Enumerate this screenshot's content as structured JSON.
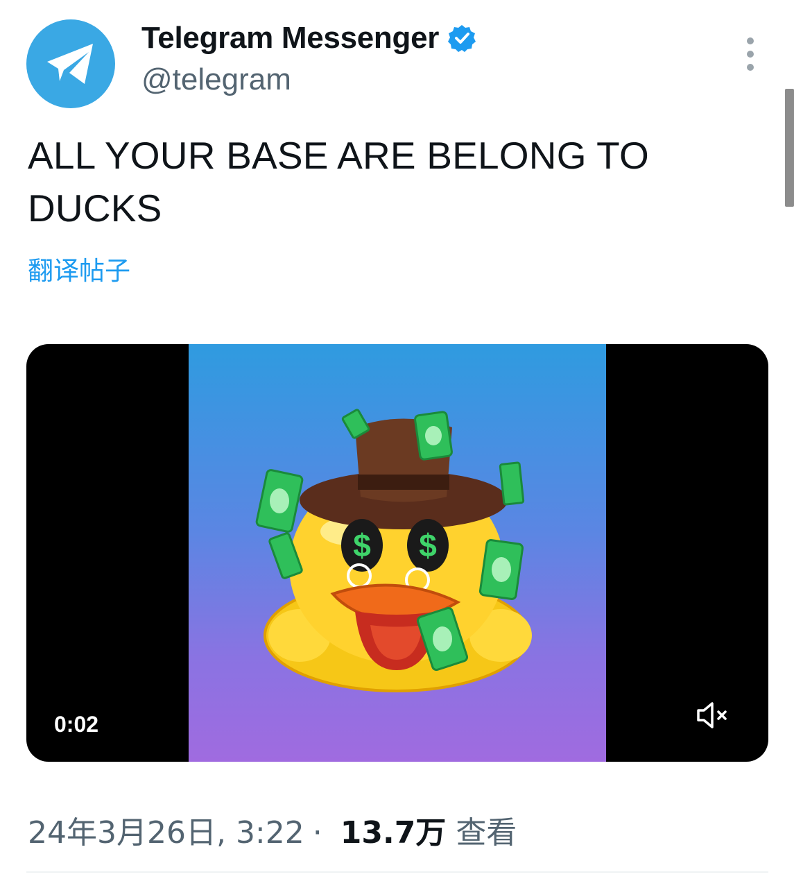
{
  "author": {
    "name": "Telegram Messenger",
    "handle": "@telegram",
    "avatar_icon": "paper-plane-icon",
    "avatar_color": "#3aa8e4",
    "verified_icon": "verified-badge-icon"
  },
  "tweet": {
    "text": "ALL YOUR BASE ARE BELONG TO DUCKS",
    "translate_label": "翻译帖子"
  },
  "media": {
    "type": "video",
    "time": "0:02",
    "mute_icon": "volume-muted-icon"
  },
  "meta": {
    "date": "24年3月26日, 3:22",
    "separator": "·",
    "views_count": "13.7万",
    "views_label": "查看"
  },
  "colors": {
    "link": "#1d9bf0",
    "secondary_text": "#536471",
    "primary_text": "#0f1419"
  }
}
